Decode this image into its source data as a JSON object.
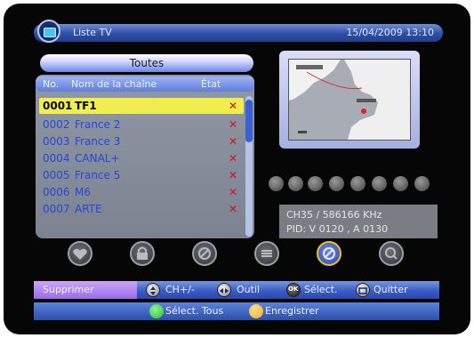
{
  "header": {
    "title": "Liste TV",
    "datetime": "15/04/2009 13:10"
  },
  "group": {
    "name": "Toutes"
  },
  "columns": {
    "no": "No.",
    "name": "Nom de la chaîne",
    "state": "État"
  },
  "channels": [
    {
      "no": "0001",
      "name": "TF1",
      "mark": "✕",
      "selected": true
    },
    {
      "no": "0002",
      "name": "France 2",
      "mark": "✕"
    },
    {
      "no": "0003",
      "name": "France 3",
      "mark": "✕"
    },
    {
      "no": "0004",
      "name": "CANAL+",
      "mark": "✕"
    },
    {
      "no": "0005",
      "name": "France 5",
      "mark": "✕"
    },
    {
      "no": "0006",
      "name": "M6",
      "mark": "✕"
    },
    {
      "no": "0007",
      "name": "ARTE",
      "mark": "✕"
    }
  ],
  "info": {
    "line1": "CH35 / 586166 KHz",
    "line2": "PID: V 0120 , A 0130"
  },
  "operations": [
    "favorite-icon",
    "lock-icon",
    "skip-icon",
    "move-icon",
    "delete-icon",
    "rename-icon"
  ],
  "help": {
    "action": "Supprimer",
    "ch": "CH+/-",
    "tool": "Outil",
    "select": "Sélect.",
    "quit": "Quitter",
    "ok": "OK"
  },
  "bottom": {
    "select_all": "Sélect. Tous",
    "save": "Enregistrer"
  },
  "colors": {
    "accent": "#3c5cc4",
    "selection": "#f0ee4e",
    "delete_mark": "#d21414",
    "green": "#2fbf3a",
    "yellow": "#f0a82a"
  }
}
